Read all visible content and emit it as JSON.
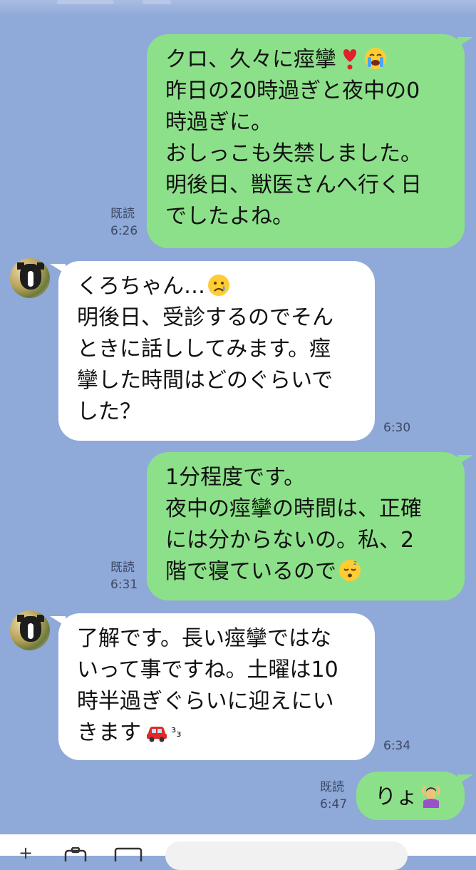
{
  "messages": [
    {
      "side": "sent",
      "lines": [
        "クロ、久々に痙攣",
        "昨日の20時過ぎと夜中の0",
        "時過ぎに。",
        "おしっこも失禁しました。",
        "明後日、獣医さんへ行く日",
        "でしたよね。"
      ],
      "emojis": [
        "heart-exclamation-icon",
        "loudly-crying-face-icon"
      ],
      "read_label": "既読",
      "time": "6:26"
    },
    {
      "side": "received",
      "lines": [
        "くろちゃん…",
        "明後日、受診するのでそん",
        "ときに話ししてみます。痙",
        "攣した時間はどのぐらいで",
        "した？"
      ],
      "emojis": [
        "crying-face-icon"
      ],
      "time": "6:30"
    },
    {
      "side": "sent",
      "lines": [
        "1分程度です。",
        "夜中の痙攣の時間は、正確",
        "には分からないの。私、2",
        "階で寝ているので"
      ],
      "emojis": [
        "sleeping-face-icon"
      ],
      "read_label": "既読",
      "time": "6:31"
    },
    {
      "side": "received",
      "lines": [
        "了解です。長い痙攣ではな",
        "いって事ですね。土曜は10",
        "時半過ぎぐらいに迎えにい",
        "きます",
        "³₃"
      ],
      "emojis": [
        "car-icon"
      ],
      "time": "6:34"
    },
    {
      "side": "sent",
      "lines": [
        "りょ"
      ],
      "emojis": [
        "person-gesturing-ok-icon"
      ],
      "read_label": "既読",
      "time": "6:47"
    }
  ],
  "colors": {
    "background": "#8fa9d8",
    "sent_bubble": "#8de08a",
    "received_bubble": "#ffffff",
    "meta_text": "#3c4a66"
  },
  "input_bar": {
    "icons": [
      "plus-icon",
      "camera-icon",
      "image-icon"
    ]
  }
}
